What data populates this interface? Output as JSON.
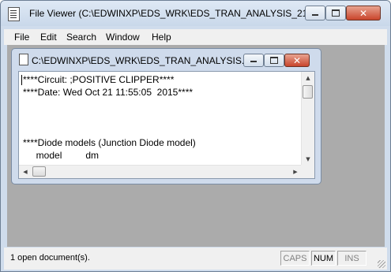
{
  "window": {
    "title": "File Viewer (C:\\EDWINXP\\EDS_WRK\\EDS_TRAN_ANALYSIS_21-..."
  },
  "menu": [
    "File",
    "Edit",
    "Search",
    "Window",
    "Help"
  ],
  "document": {
    "title": "C:\\EDWINXP\\EDS_WRK\\EDS_TRAN_ANALYSIS...",
    "lines": [
      "****Circuit: ;POSITIVE CLIPPER****",
      "****Date: Wed Oct 21 11:55:05  2015****",
      "",
      "",
      "",
      "****Diode models (Junction Diode model)",
      "     model         dm"
    ]
  },
  "status": {
    "message": "1 open document(s).",
    "caps": "CAPS",
    "num": "NUM",
    "ins": "INS"
  },
  "colors": {
    "close_button": "#c9452c",
    "mdi_background": "#ababab",
    "frame": "#cfdcec"
  }
}
